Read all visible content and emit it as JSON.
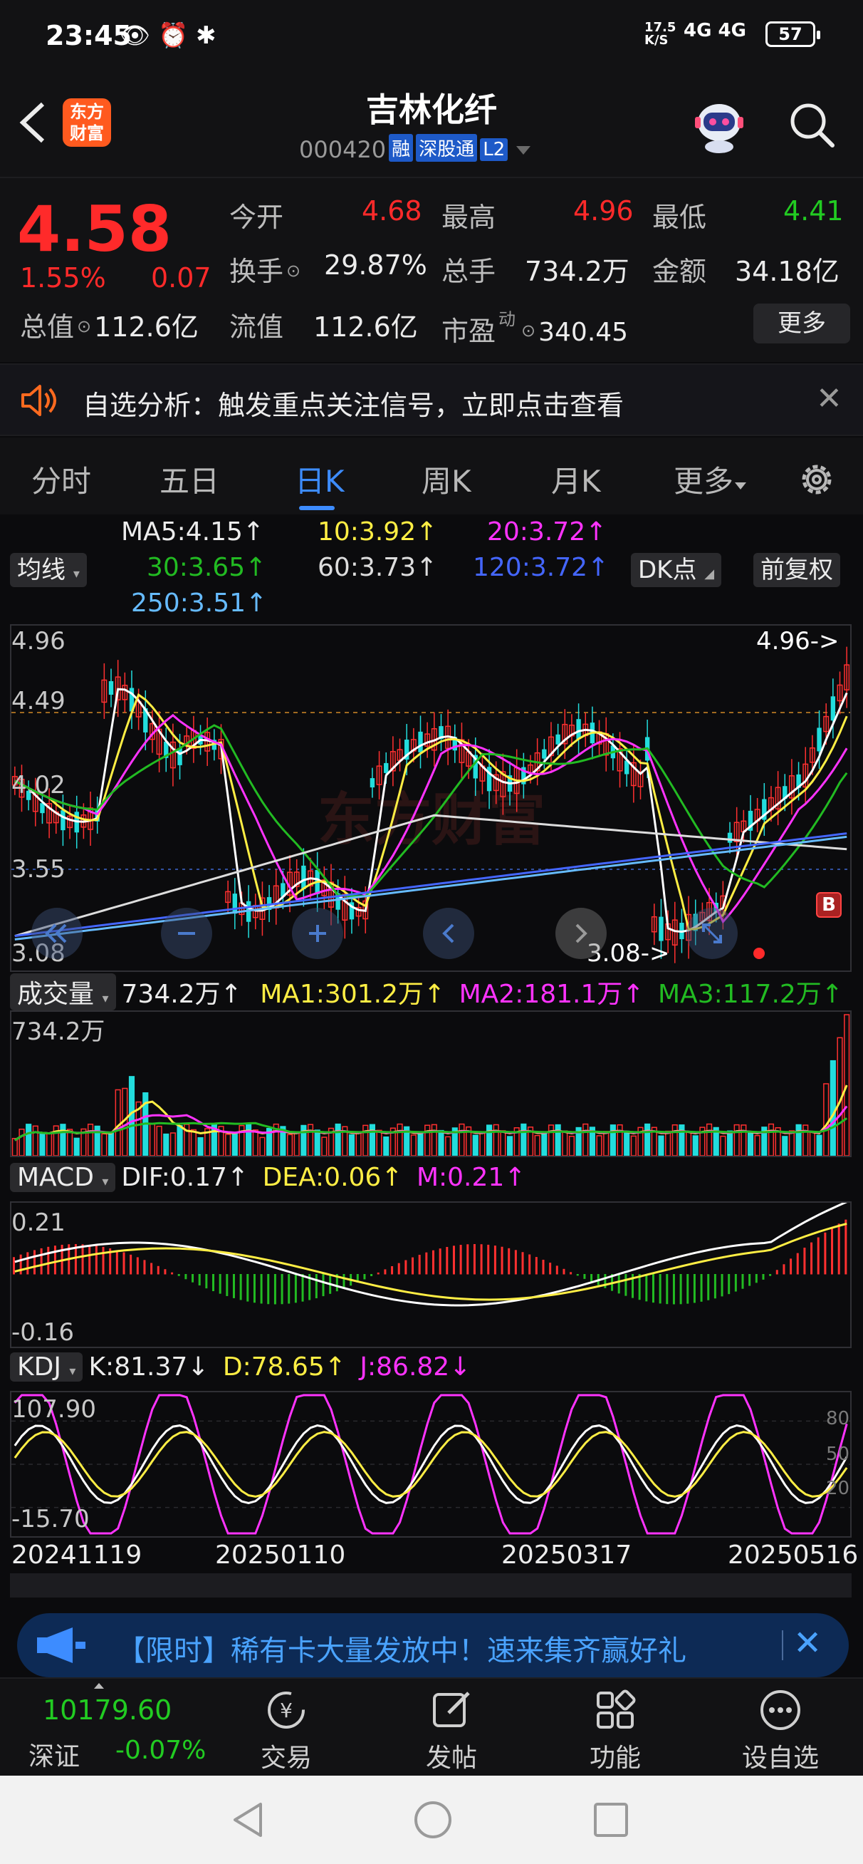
{
  "status": {
    "time": "23:45",
    "icons": "👁 ⏰ ✱",
    "net_speed_top": "17.5",
    "net_speed_bottom": "K/S",
    "signal": "4G 4G",
    "battery": "57"
  },
  "header": {
    "logo_line1": "东方",
    "logo_line2": "财富",
    "title": "吉林化纤",
    "code": "000420",
    "tags": [
      "融",
      "深股通",
      "L2"
    ]
  },
  "quote": {
    "price": "4.58",
    "change_pct": "1.55%",
    "change": "0.07",
    "open_label": "今开",
    "open": "4.68",
    "high_label": "最高",
    "high": "4.96",
    "low_label": "最低",
    "low": "4.41",
    "turnover_label": "换手",
    "turnover": "29.87%",
    "volume_label": "总手",
    "volume": "734.2万",
    "amount_label": "金额",
    "amount": "34.18亿",
    "mktcap_label": "总值",
    "mktcap": "112.6亿",
    "float_label": "流值",
    "float": "112.6亿",
    "pe_label": "市盈",
    "pe_sup": "动",
    "pe": "340.45",
    "more_label": "更多"
  },
  "notice": {
    "text": "自选分析：触发重点关注信号，立即点击查看"
  },
  "tabs": [
    "分时",
    "五日",
    "日K",
    "周K",
    "月K",
    "更多"
  ],
  "ma": {
    "selector": "均线",
    "ma5": "MA5:4.15↑",
    "ma10": "10:3.92↑",
    "ma20": "20:3.72↑",
    "ma30": "30:3.65↑",
    "ma60": "60:3.73↑",
    "ma120": "120:3.72↑",
    "ma250": "250:3.51↑",
    "dk_label": "DK点",
    "adjust_label": "前复权"
  },
  "kline": {
    "axis_top": "4.96",
    "axis_2": "4.49",
    "axis_3": "4.02",
    "axis_4": "3.55",
    "axis_bottom": "3.08",
    "max_mark": "4.96->",
    "min_mark": "3.08->",
    "b_badge": "B"
  },
  "volume": {
    "label": "成交量",
    "value": "734.2万↑",
    "ma1": "MA1:301.2万↑",
    "ma2": "MA2:181.1万↑",
    "ma3": "MA3:117.2万↑",
    "axis_top": "734.2万"
  },
  "macd": {
    "label": "MACD",
    "dif": "DIF:0.17↑",
    "dea": "DEA:0.06↑",
    "m": "M:0.21↑",
    "axis_top": "0.21",
    "axis_bottom": "-0.16"
  },
  "kdj": {
    "label": "KDJ",
    "k": "K:81.37↓",
    "d": "D:78.65↑",
    "j": "J:86.82↓",
    "axis_top": "107.90",
    "axis_bottom": "-15.70",
    "lvl_80": "80",
    "lvl_50": "50",
    "lvl_20": "20"
  },
  "dates": [
    "20241119",
    "20250110",
    "20250317",
    "20250516"
  ],
  "promo": {
    "text": "【限时】稀有卡大量发放中！速来集齐赢好礼"
  },
  "bottom_nav": {
    "index_value": "10179.60",
    "index_name": "深证",
    "index_change": "-0.07%",
    "items": [
      "交易",
      "发帖",
      "功能",
      "设自选"
    ]
  },
  "colors": {
    "up": "#ff2a2a",
    "down": "#22cc22",
    "accent": "#3d8cff",
    "ma5": "#ffffff",
    "ma10": "#ffee44",
    "ma20": "#ff33ff",
    "ma30": "#22bb22",
    "ma60": "#dddddd",
    "ma120": "#4466ff",
    "ma250": "#66bbff"
  }
}
